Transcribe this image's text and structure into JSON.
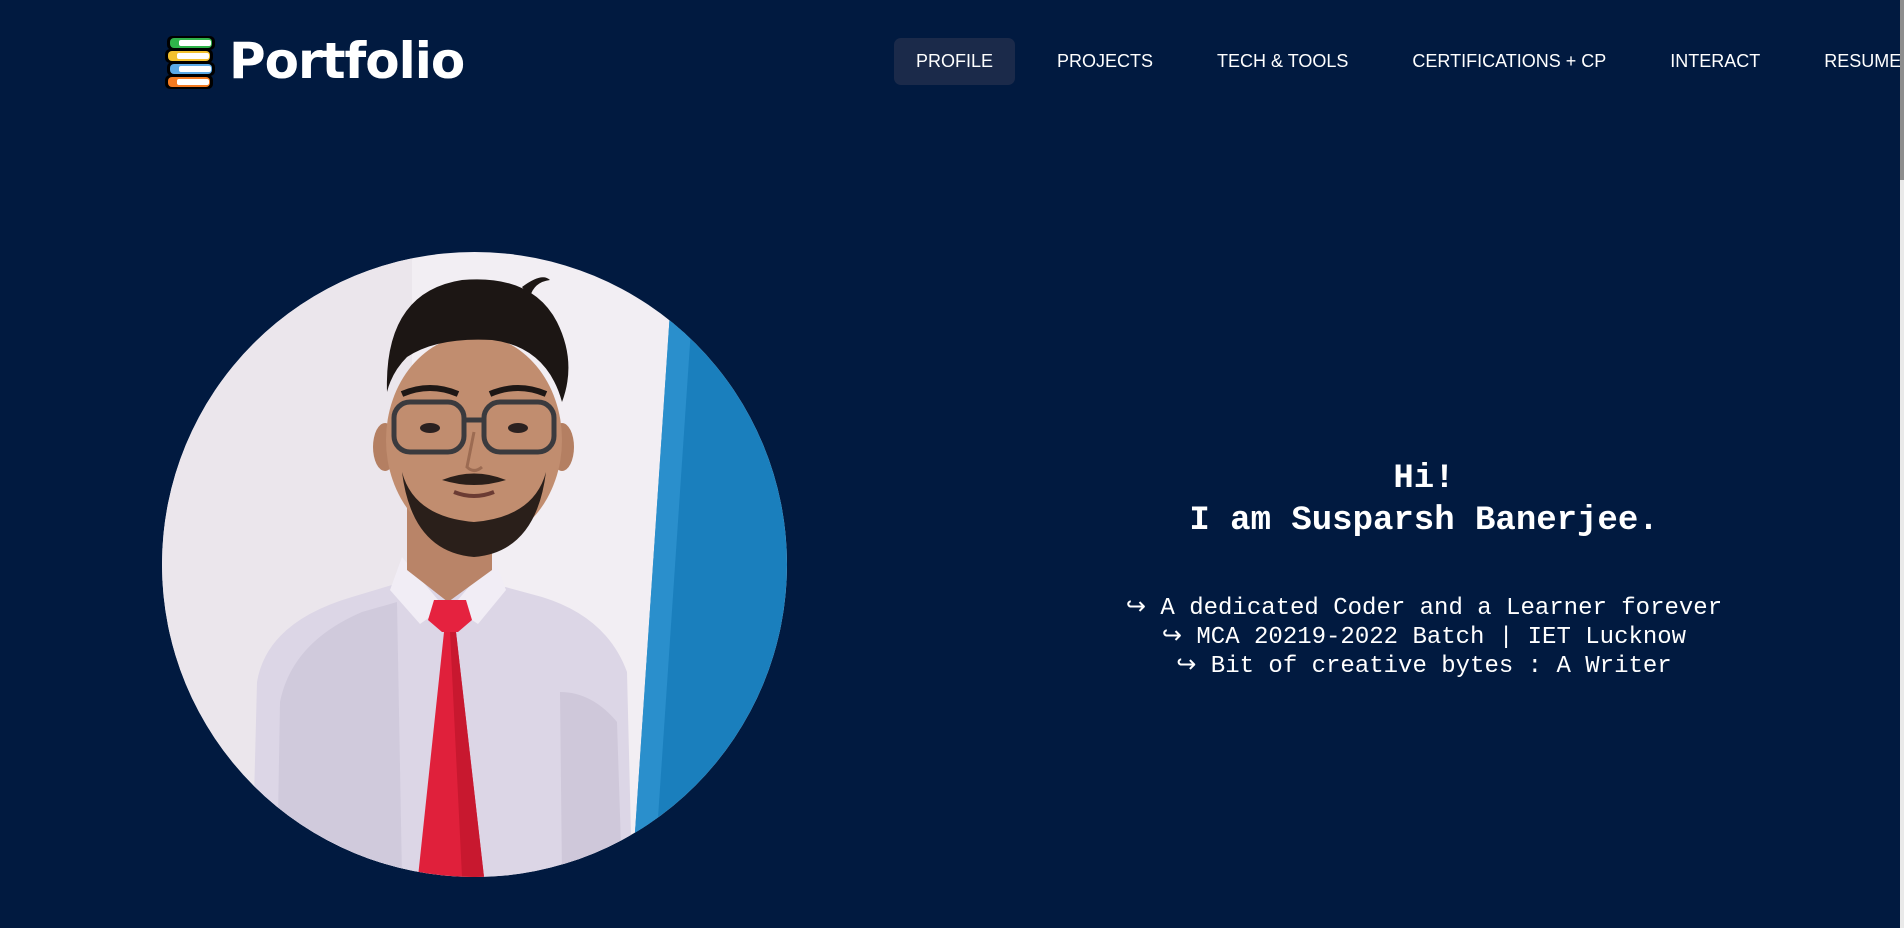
{
  "header": {
    "brand": "Portfolio",
    "brand_icon": "stacked-books-icon",
    "nav": [
      {
        "label": "PROFILE",
        "active": true
      },
      {
        "label": "PROJECTS",
        "active": false
      },
      {
        "label": "TECH & TOOLS",
        "active": false
      },
      {
        "label": "CERTIFICATIONS + CP",
        "active": false
      },
      {
        "label": "INTERACT",
        "active": false
      },
      {
        "label": "RESUME",
        "active": false
      }
    ]
  },
  "hero": {
    "greeting_line1": "Hi!",
    "greeting_line2": "I am Susparsh Banerjee.",
    "taglines": [
      "↪ A dedicated Coder and a Learner forever",
      "↪ MCA 20219-2022 Batch | IET Lucknow",
      "↪ Bit of creative bytes : A Writer"
    ]
  },
  "colors": {
    "background": "#011a40",
    "nav_active_bg": "#1b2a4a",
    "text": "#ffffff"
  }
}
